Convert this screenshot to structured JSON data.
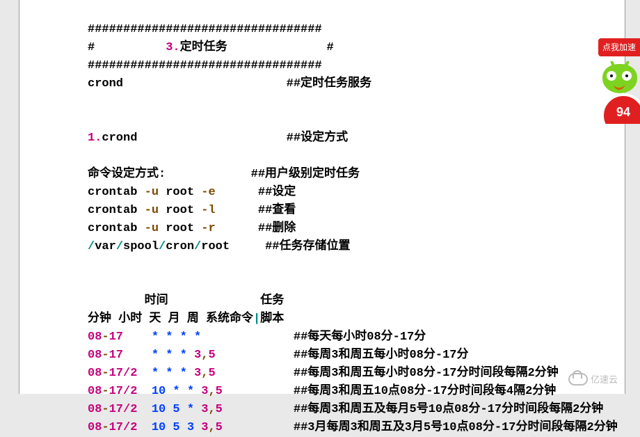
{
  "header": {
    "border_top": "#################################",
    "title_left": "#          ",
    "title_num": "3.",
    "title_text": "定时任务",
    "title_right": "              #",
    "border_bottom": "#################################"
  },
  "crond_service": {
    "cmd": "crond",
    "pad": "                       ",
    "desc": "##定时任务服务"
  },
  "section1": {
    "num": "1.",
    "label": "crond",
    "pad": "                     ",
    "desc": "##设定方式"
  },
  "cmds": {
    "heading": {
      "text": "命令设定方式",
      "colon": ":",
      "pad": "            ",
      "desc": "##用户级别定时任务"
    },
    "rows": [
      {
        "c": "crontab ",
        "f1": "-u",
        "s1": " root ",
        "f2": "-e",
        "pad": "      ",
        "desc": "##设定"
      },
      {
        "c": "crontab ",
        "f1": "-u",
        "s1": " root ",
        "f2": "-l",
        "pad": "      ",
        "desc": "##查看"
      },
      {
        "c": "crontab ",
        "f1": "-u",
        "s1": " root ",
        "f2": "-r",
        "pad": "      ",
        "desc": "##删除"
      }
    ],
    "path": {
      "p1": "/",
      "p2": "var",
      "p3": "/",
      "p4": "spool",
      "p5": "/",
      "p6": "cron",
      "p7": "/",
      "p8": "root",
      "pad": "     ",
      "desc": "##任务存储位置"
    }
  },
  "table": {
    "head1": {
      "pad1": "        ",
      "time": "时间",
      "pad2": "             ",
      "task": "任务"
    },
    "head2": {
      "c1": "分钟 ",
      "c2": "小时 ",
      "c3": "天 ",
      "c4": "月 ",
      "c5": "周 ",
      "c6": "系统命令",
      "bar": "|",
      "c7": "脚本"
    },
    "rows": [
      {
        "a": "08",
        "d": "-",
        "b": "17",
        "sep": "    ",
        "stars": "* * * *",
        "pad": "             ",
        "desc": "##每天每小时08分-17分"
      },
      {
        "a": "08",
        "d": "-",
        "b": "17",
        "sep": "    ",
        "stars": "* * * ",
        "ds": "3",
        "dc": ",",
        "de": "5",
        "pad": "           ",
        "desc": "##每周3和周五每小时08分-17分"
      },
      {
        "a": "08",
        "d": "-",
        "b": "17/2",
        "sep": "  ",
        "stars": "* * * ",
        "ds": "3",
        "dc": ",",
        "de": "5",
        "pad": "           ",
        "desc": "##每周3和周五每小时08分-17分时间段每隔2分钟"
      },
      {
        "a": "08",
        "d": "-",
        "b": "17/2",
        "sep": "  ",
        "stars": "10 * * ",
        "ds": "3",
        "dc": ",",
        "de": "5",
        "pad": "          ",
        "desc": "##每周3和周五10点08分-17分时间段每4隔2分钟"
      },
      {
        "a": "08",
        "d": "-",
        "b": "17/2",
        "sep": "  ",
        "stars": "10 5 * ",
        "ds": "3",
        "dc": ",",
        "de": "5",
        "pad": "          ",
        "desc": "##每周3和周五及每月5号10点08分-17分时间段每隔2分钟"
      },
      {
        "a": "08",
        "d": "-",
        "b": "17/2",
        "sep": "  ",
        "stars": "10 5 3 ",
        "ds": "3",
        "dc": ",",
        "de": "5",
        "pad": "          ",
        "desc": "##3月每周3和周五及3月5号10点08分-17分时间段每隔2分钟"
      }
    ]
  },
  "widgets": {
    "speed": "点我加速",
    "badge": "94",
    "brand": "亿速云"
  }
}
